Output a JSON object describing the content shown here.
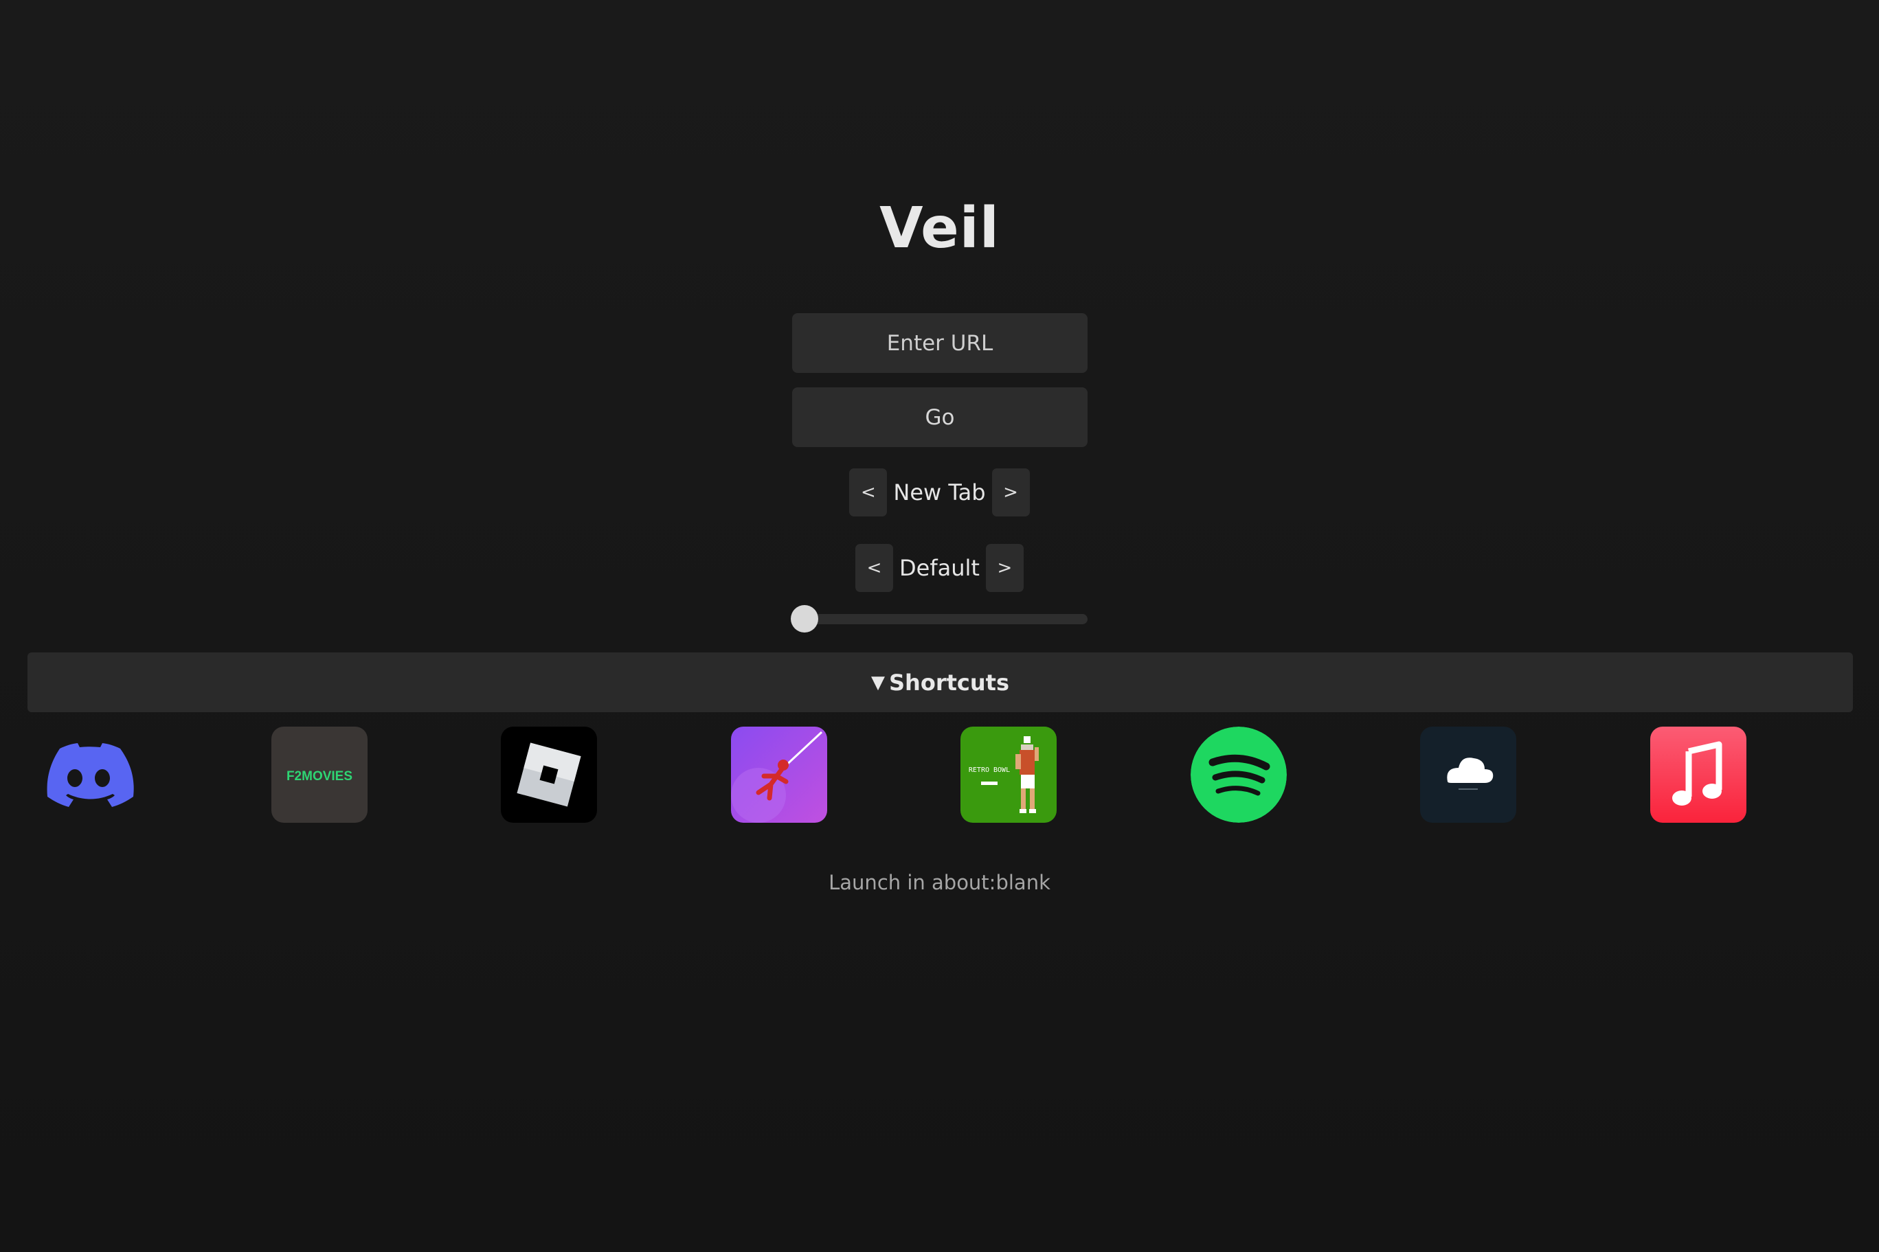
{
  "app": {
    "title": "Veil"
  },
  "search": {
    "placeholder": "Enter URL",
    "value": "",
    "go_label": "Go"
  },
  "open_mode": {
    "prev_label": "<",
    "value": "New Tab",
    "next_label": ">"
  },
  "theme": {
    "prev_label": "<",
    "value": "Default",
    "next_label": ">"
  },
  "slider": {
    "value": 0
  },
  "shortcuts": {
    "label": "Shortcuts",
    "toggle_glyph": "▼",
    "expanded": true,
    "items": [
      {
        "name": "Discord",
        "icon": "discord-icon",
        "color": "#5865F2"
      },
      {
        "name": "F2Movies",
        "icon": "f2movies-icon",
        "text": "F2MOVIES",
        "color": "#2ed573"
      },
      {
        "name": "Roblox",
        "icon": "roblox-icon",
        "color": "#000000"
      },
      {
        "name": "Stickman Hook",
        "icon": "stickman-hook-icon",
        "color": "#a24bf0"
      },
      {
        "name": "Retro Bowl",
        "icon": "retro-bowl-icon",
        "text": "RETRO BOWL",
        "color": "#3a9a0e"
      },
      {
        "name": "Spotify",
        "icon": "spotify-icon",
        "color": "#1ed760"
      },
      {
        "name": "Cloud",
        "icon": "cloud-icon",
        "color": "#14202a"
      },
      {
        "name": "Apple Music",
        "icon": "apple-music-icon",
        "color": "#fa2d48"
      }
    ]
  },
  "footer": {
    "launch_label": "Launch in about:blank"
  },
  "colors": {
    "background": "#171717",
    "control": "#2c2c2c",
    "text": "#e6e6e6"
  }
}
